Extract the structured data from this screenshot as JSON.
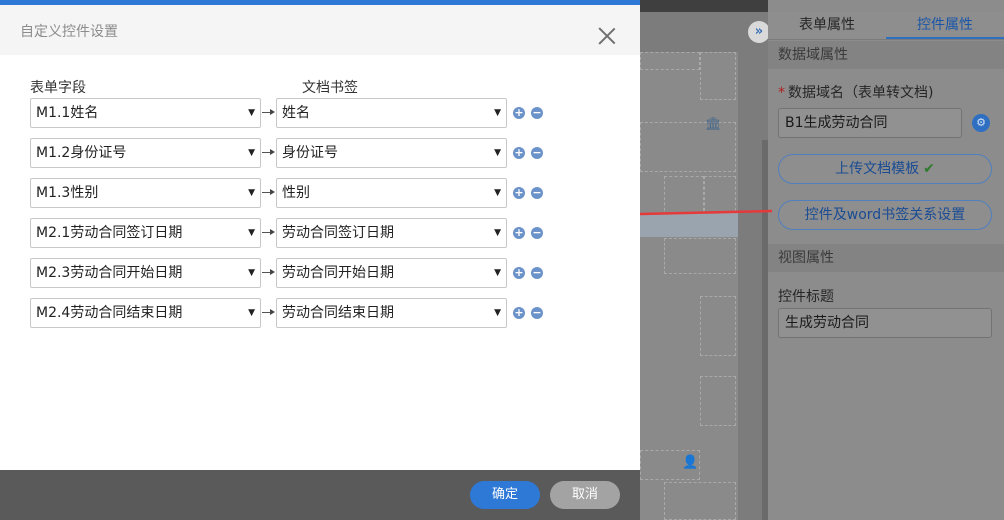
{
  "modal": {
    "title": "自定义控件设置",
    "columns": {
      "field": "表单字段",
      "bookmark": "文档书签"
    },
    "rows": [
      {
        "field": "M1.1姓名",
        "bookmark": "姓名"
      },
      {
        "field": "M1.2身份证号",
        "bookmark": "身份证号"
      },
      {
        "field": "M1.3性别",
        "bookmark": "性别"
      },
      {
        "field": "M2.1劳动合同签订日期",
        "bookmark": "劳动合同签订日期"
      },
      {
        "field": "M2.3劳动合同开始日期",
        "bookmark": "劳动合同开始日期"
      },
      {
        "field": "M2.4劳动合同结束日期",
        "bookmark": "劳动合同结束日期"
      }
    ],
    "add_glyph": "+",
    "remove_glyph": "−",
    "caret_glyph": "▼",
    "ok_label": "确定",
    "cancel_label": "取消"
  },
  "right_panel": {
    "tabs": [
      "表单属性",
      "控件属性"
    ],
    "active_tab": 1,
    "section_data": "数据域属性",
    "data_domain_label": "数据域名（表单转文档)",
    "data_domain_value": "B1生成劳动合同",
    "upload_label": "上传文档模板",
    "upload_check": "✔",
    "mapping_label": "控件及word书签关系设置",
    "section_view": "视图属性",
    "control_title_label": "控件标题",
    "control_title_value": "生成劳动合同"
  },
  "background": {
    "collapse_glyph": "»"
  },
  "icons": {
    "close": "close-icon",
    "add": "plus-circle-icon",
    "remove": "minus-circle-icon",
    "dropdown": "chevron-down-icon",
    "annotation": "red-arrow-icon",
    "bank": "bank-icon",
    "user": "user-icon",
    "gear": "gear-icon"
  },
  "colors": {
    "primary": "#2f79d6",
    "cancel": "#a3a3a3",
    "annotation_arrow": "#e5393a",
    "action_circle": "#6b93c9"
  }
}
